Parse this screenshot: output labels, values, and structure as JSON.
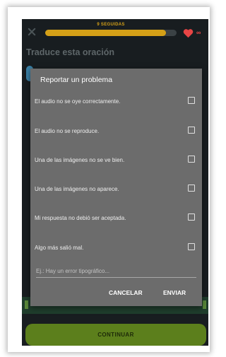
{
  "lesson": {
    "streak_label": "9 SEGUIDAS",
    "progress": 0.92,
    "hearts": "∞",
    "prompt": "Traduce esta oración",
    "continue_label": "CONTINUAR"
  },
  "report_dialog": {
    "title": "Reportar un problema",
    "options": [
      {
        "label": "El audio no se oye correctamente."
      },
      {
        "label": "El audio no se reproduce."
      },
      {
        "label": "Una de las imágenes no se ve bien."
      },
      {
        "label": "Una de las imágenes no aparece."
      },
      {
        "label": "Mi respuesta no debió ser aceptada."
      },
      {
        "label": "Algo más salió mal."
      }
    ],
    "input_placeholder": "Ej.: Hay un error tipográfico...",
    "input_value": "",
    "cancel_label": "CANCELAR",
    "send_label": "ENVIAR"
  },
  "colors": {
    "progress": "#d4a017",
    "heart": "#e84545",
    "continue_button": "#5c7f1c",
    "dialog_bg": "#6c6c6c"
  },
  "icons": {
    "close": "close-icon",
    "heart": "heart-icon",
    "checkbox": "checkbox-unchecked"
  }
}
